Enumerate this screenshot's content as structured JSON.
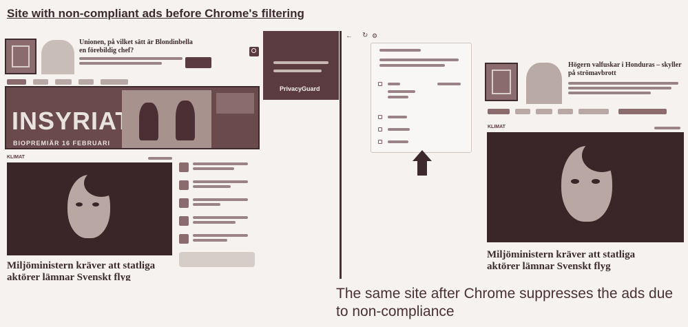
{
  "headings": {
    "before": "Site with non-compliant ads before Chrome's filtering",
    "after": "The same site after Chrome suppresses the ads due to non-compliance"
  },
  "left_site": {
    "top_headline": "Unionen, på vilket sätt är Blondinbella en förebildig chef?",
    "banner_title": "INSYRIATED",
    "banner_sub": "BIOPREMIÄR 16 FEBRUARI",
    "section_label": "KLIMAT",
    "main_headline": "Miljöministern kräver att statliga aktörer lämnar Svenskt flyg",
    "popup_label": "PrivacyGuard"
  },
  "right_site": {
    "top_headline": "Högern valfuskar i Honduras – skyller på strömavbrott",
    "section_label": "KLIMAT",
    "main_headline": "Miljöministern kräver att statliga aktörer lämnar Svenskt flyg"
  },
  "icons": {
    "search": "search-icon",
    "arrow": "up-arrow-icon",
    "back": "back-arrow-icon",
    "reload": "reload-icon"
  },
  "colors": {
    "dark": "#5a3b3f",
    "background": "#f5f2ef",
    "text": "#3d2a2e"
  }
}
